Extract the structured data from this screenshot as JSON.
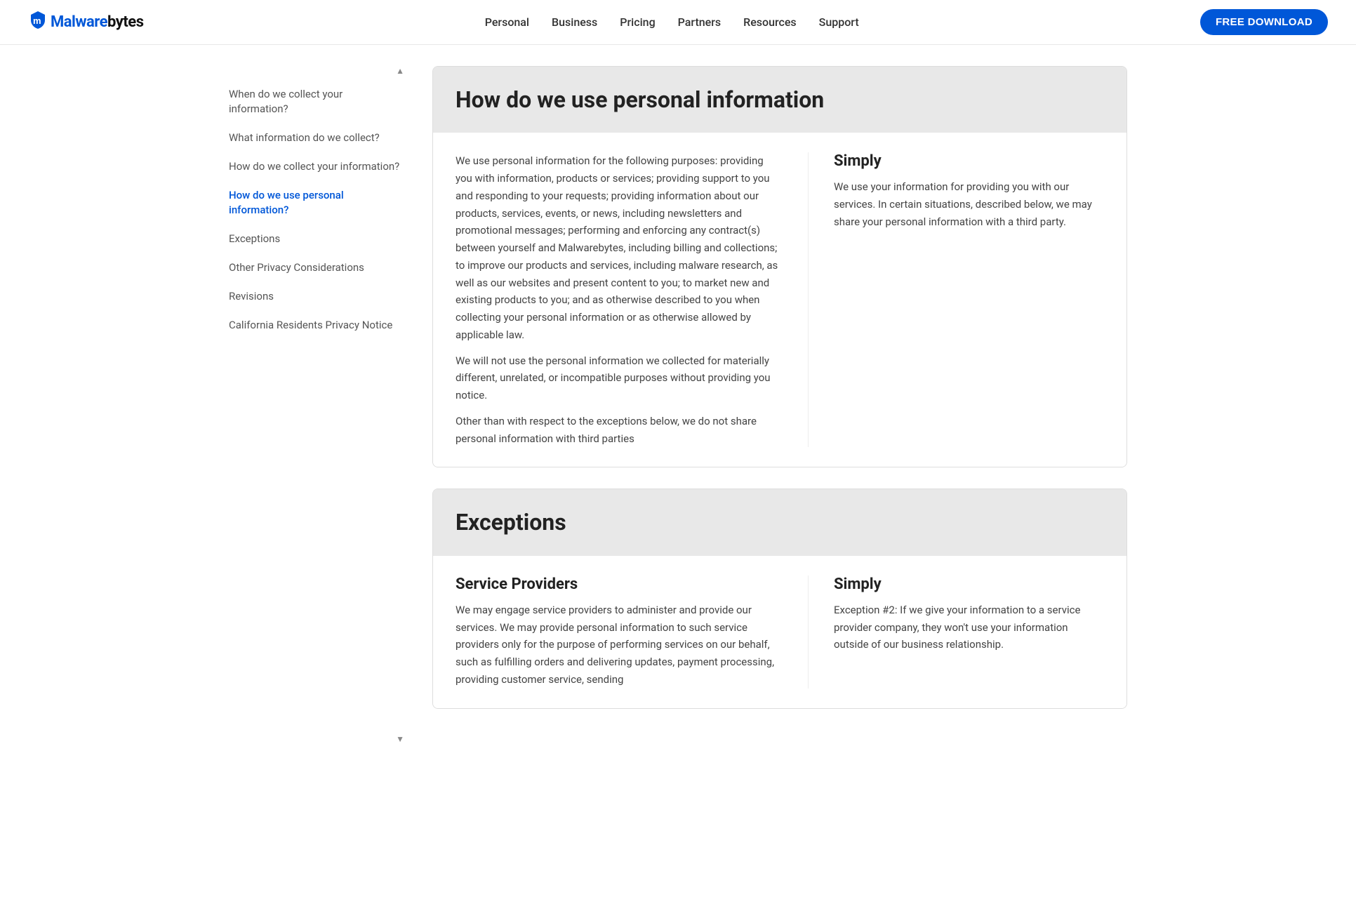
{
  "header": {
    "logo_bold": "Malware",
    "logo_regular": "bytes",
    "nav": [
      {
        "label": "Personal",
        "id": "personal"
      },
      {
        "label": "Business",
        "id": "business"
      },
      {
        "label": "Pricing",
        "id": "pricing"
      },
      {
        "label": "Partners",
        "id": "partners"
      },
      {
        "label": "Resources",
        "id": "resources"
      },
      {
        "label": "Support",
        "id": "support"
      }
    ],
    "cta_label": "FREE DOWNLOAD"
  },
  "sidebar": {
    "scroll_up": "▲",
    "scroll_down": "▼",
    "items": [
      {
        "label": "When do we collect your information?",
        "id": "collect-when",
        "active": false
      },
      {
        "label": "What information do we collect?",
        "id": "collect-what",
        "active": false
      },
      {
        "label": "How do we collect your information?",
        "id": "collect-how",
        "active": false
      },
      {
        "label": "How do we use personal information?",
        "id": "use-personal",
        "active": true
      },
      {
        "label": "Exceptions",
        "id": "exceptions",
        "active": false
      },
      {
        "label": "Other Privacy Considerations",
        "id": "other-privacy",
        "active": false
      },
      {
        "label": "Revisions",
        "id": "revisions",
        "active": false
      },
      {
        "label": "California Residents Privacy Notice",
        "id": "california",
        "active": false
      }
    ]
  },
  "sections": [
    {
      "id": "use-personal",
      "title": "How do we use personal information",
      "left_text_paragraphs": [
        "We use personal information for the following purposes: providing you with information, products or services; providing support to you and responding to your requests; providing information about our products, services, events, or news, including newsletters and promotional messages; performing and enforcing any contract(s) between yourself and Malwarebytes, including billing and collections; to improve our products and services, including malware research, as well as our websites and present content to you; to market new and existing products to you; and as otherwise described to you when collecting your personal information or as otherwise allowed by applicable law.",
        "We will not use the personal information we collected for materially different, unrelated, or incompatible purposes without providing you notice.",
        "Other than with respect to the exceptions below, we do not share personal information with third parties"
      ],
      "right_title": "Simply",
      "right_text": "We use your information for providing you with our services. In certain situations, described below, we may share your personal information with a third party."
    },
    {
      "id": "exceptions",
      "title": "Exceptions",
      "service_title": "Service Providers",
      "service_text": "We may engage service providers to administer and provide our services. We may provide personal information to such service providers only for the purpose of performing services on our behalf, such as fulfilling orders and delivering updates, payment processing, providing customer service, sending",
      "right_title": "Simply",
      "right_text": "Exception #2: If we give your information to a service provider company, they won't use your information outside of our business relationship."
    }
  ]
}
